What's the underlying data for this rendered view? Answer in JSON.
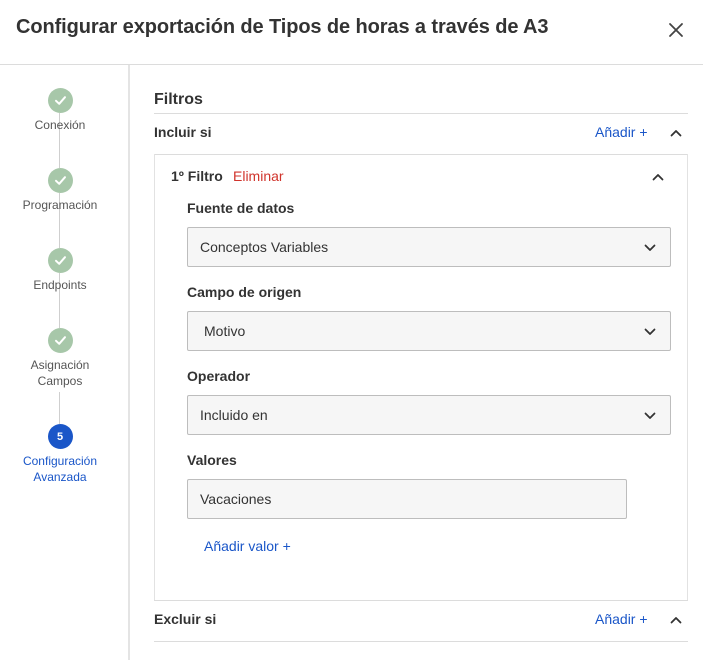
{
  "header": {
    "title": "Configurar exportación de Tipos de horas a través de A3",
    "close_icon": "close-icon"
  },
  "steps": [
    {
      "label_lines": [
        "Conexión"
      ],
      "status": "done",
      "icon": "check-icon"
    },
    {
      "label_lines": [
        "Programación"
      ],
      "status": "done",
      "icon": "check-icon"
    },
    {
      "label_lines": [
        "Endpoints"
      ],
      "status": "done",
      "icon": "check-icon"
    },
    {
      "label_lines": [
        "Asignación",
        "Campos"
      ],
      "status": "done",
      "icon": "check-icon"
    },
    {
      "label_lines": [
        "Configuración",
        "Avanzada"
      ],
      "status": "active",
      "number": "5"
    }
  ],
  "main": {
    "section_title": "Filtros",
    "include": {
      "label": "Incluir si",
      "add_label": "Añadir +"
    },
    "filter": {
      "title": "1º Filtro",
      "delete_label": "Eliminar",
      "fields": {
        "source": {
          "label": "Fuente de datos",
          "value": "Conceptos Variables"
        },
        "origin": {
          "label": "Campo de origen",
          "value": "Motivo"
        },
        "operator": {
          "label": "Operador",
          "value": "Incluido en"
        },
        "values": {
          "label": "Valores",
          "value": "Vacaciones",
          "add_label": "Añadir valor +"
        }
      }
    },
    "exclude": {
      "label": "Excluir si",
      "add_label": "Añadir +"
    }
  },
  "colors": {
    "accent": "#1a56c8",
    "danger": "#d0342c",
    "step_done": "#a7c7a9"
  }
}
